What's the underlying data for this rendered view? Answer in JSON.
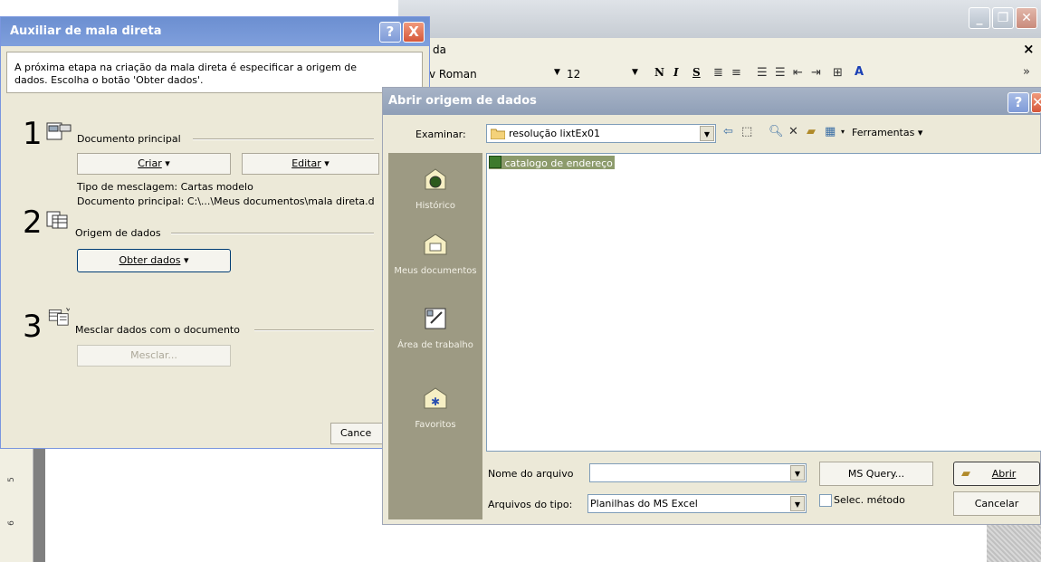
{
  "word": {
    "menu_fragment": "da",
    "font_name": "v Roman",
    "font_size": "12",
    "format_buttons": [
      "N",
      "I",
      "S"
    ],
    "ruler_marks": [
      "5",
      "6"
    ]
  },
  "mail_merge": {
    "title": "Auxiliar de mala direta",
    "help_label": "?",
    "close_label": "X",
    "intro_line1": "A próxima etapa na criação da mala direta é especificar a origem de",
    "intro_line2": "dados. Escolha o botão 'Obter dados'.",
    "step1": {
      "number": "1",
      "label": "Documento principal",
      "create_button": "Criar",
      "edit_button": "Editar",
      "merge_type": "Tipo de mesclagem: Cartas modelo",
      "main_document": "Documento principal: C:\\...\\Meus documentos\\mala direta.d"
    },
    "step2": {
      "number": "2",
      "label": "Origem de dados",
      "get_data_button": "Obter dados"
    },
    "step3": {
      "number": "3",
      "label": "Mesclar dados com o documento",
      "merge_button": "Mesclar..."
    },
    "cancel_button": "Cance"
  },
  "open_dialog": {
    "title": "Abrir origem de dados",
    "look_in_label": "Examinar:",
    "look_in_value": "resolução lixtEx01",
    "tools_label": "Ferramentas",
    "places": [
      {
        "name": "history-place",
        "label": "Histórico"
      },
      {
        "name": "my-documents-place",
        "label": "Meus documentos"
      },
      {
        "name": "desktop-place",
        "label": "Área de trabalho"
      },
      {
        "name": "favorites-place",
        "label": "Favoritos"
      }
    ],
    "files": [
      "catalogo de endereço"
    ],
    "file_name_label": "Nome do arquivo",
    "file_name_value": "",
    "file_type_label": "Arquivos do tipo:",
    "file_type_value": "Planilhas do MS Excel",
    "ms_query_button": "MS Query...",
    "select_method_label": "Selec. método",
    "open_button": "Abrir",
    "cancel_button": "Cancelar"
  },
  "colors": {
    "xp_blue_title": "#7f9fdc",
    "dialog_face": "#ece9d8",
    "places_bar": "#9d9a83",
    "selection": "#8d9b6c"
  }
}
